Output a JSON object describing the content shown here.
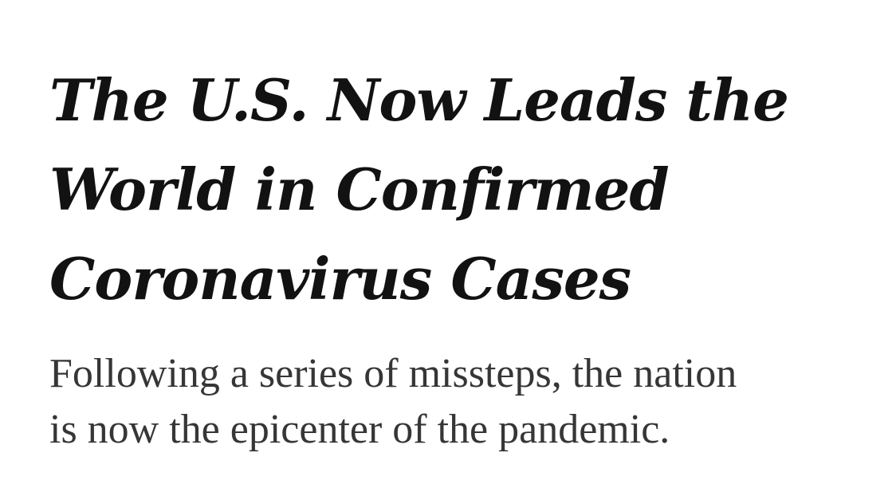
{
  "article": {
    "headline_lines": [
      "The U.S. Now Leads the",
      "World in Confirmed",
      "Coronavirus Cases"
    ],
    "summary_lines": [
      "Following a series of missteps, the nation",
      "is now the epicenter of the pandemic."
    ]
  },
  "colors": {
    "background": "#ffffff",
    "headline": "#121212",
    "summary": "#363636"
  }
}
